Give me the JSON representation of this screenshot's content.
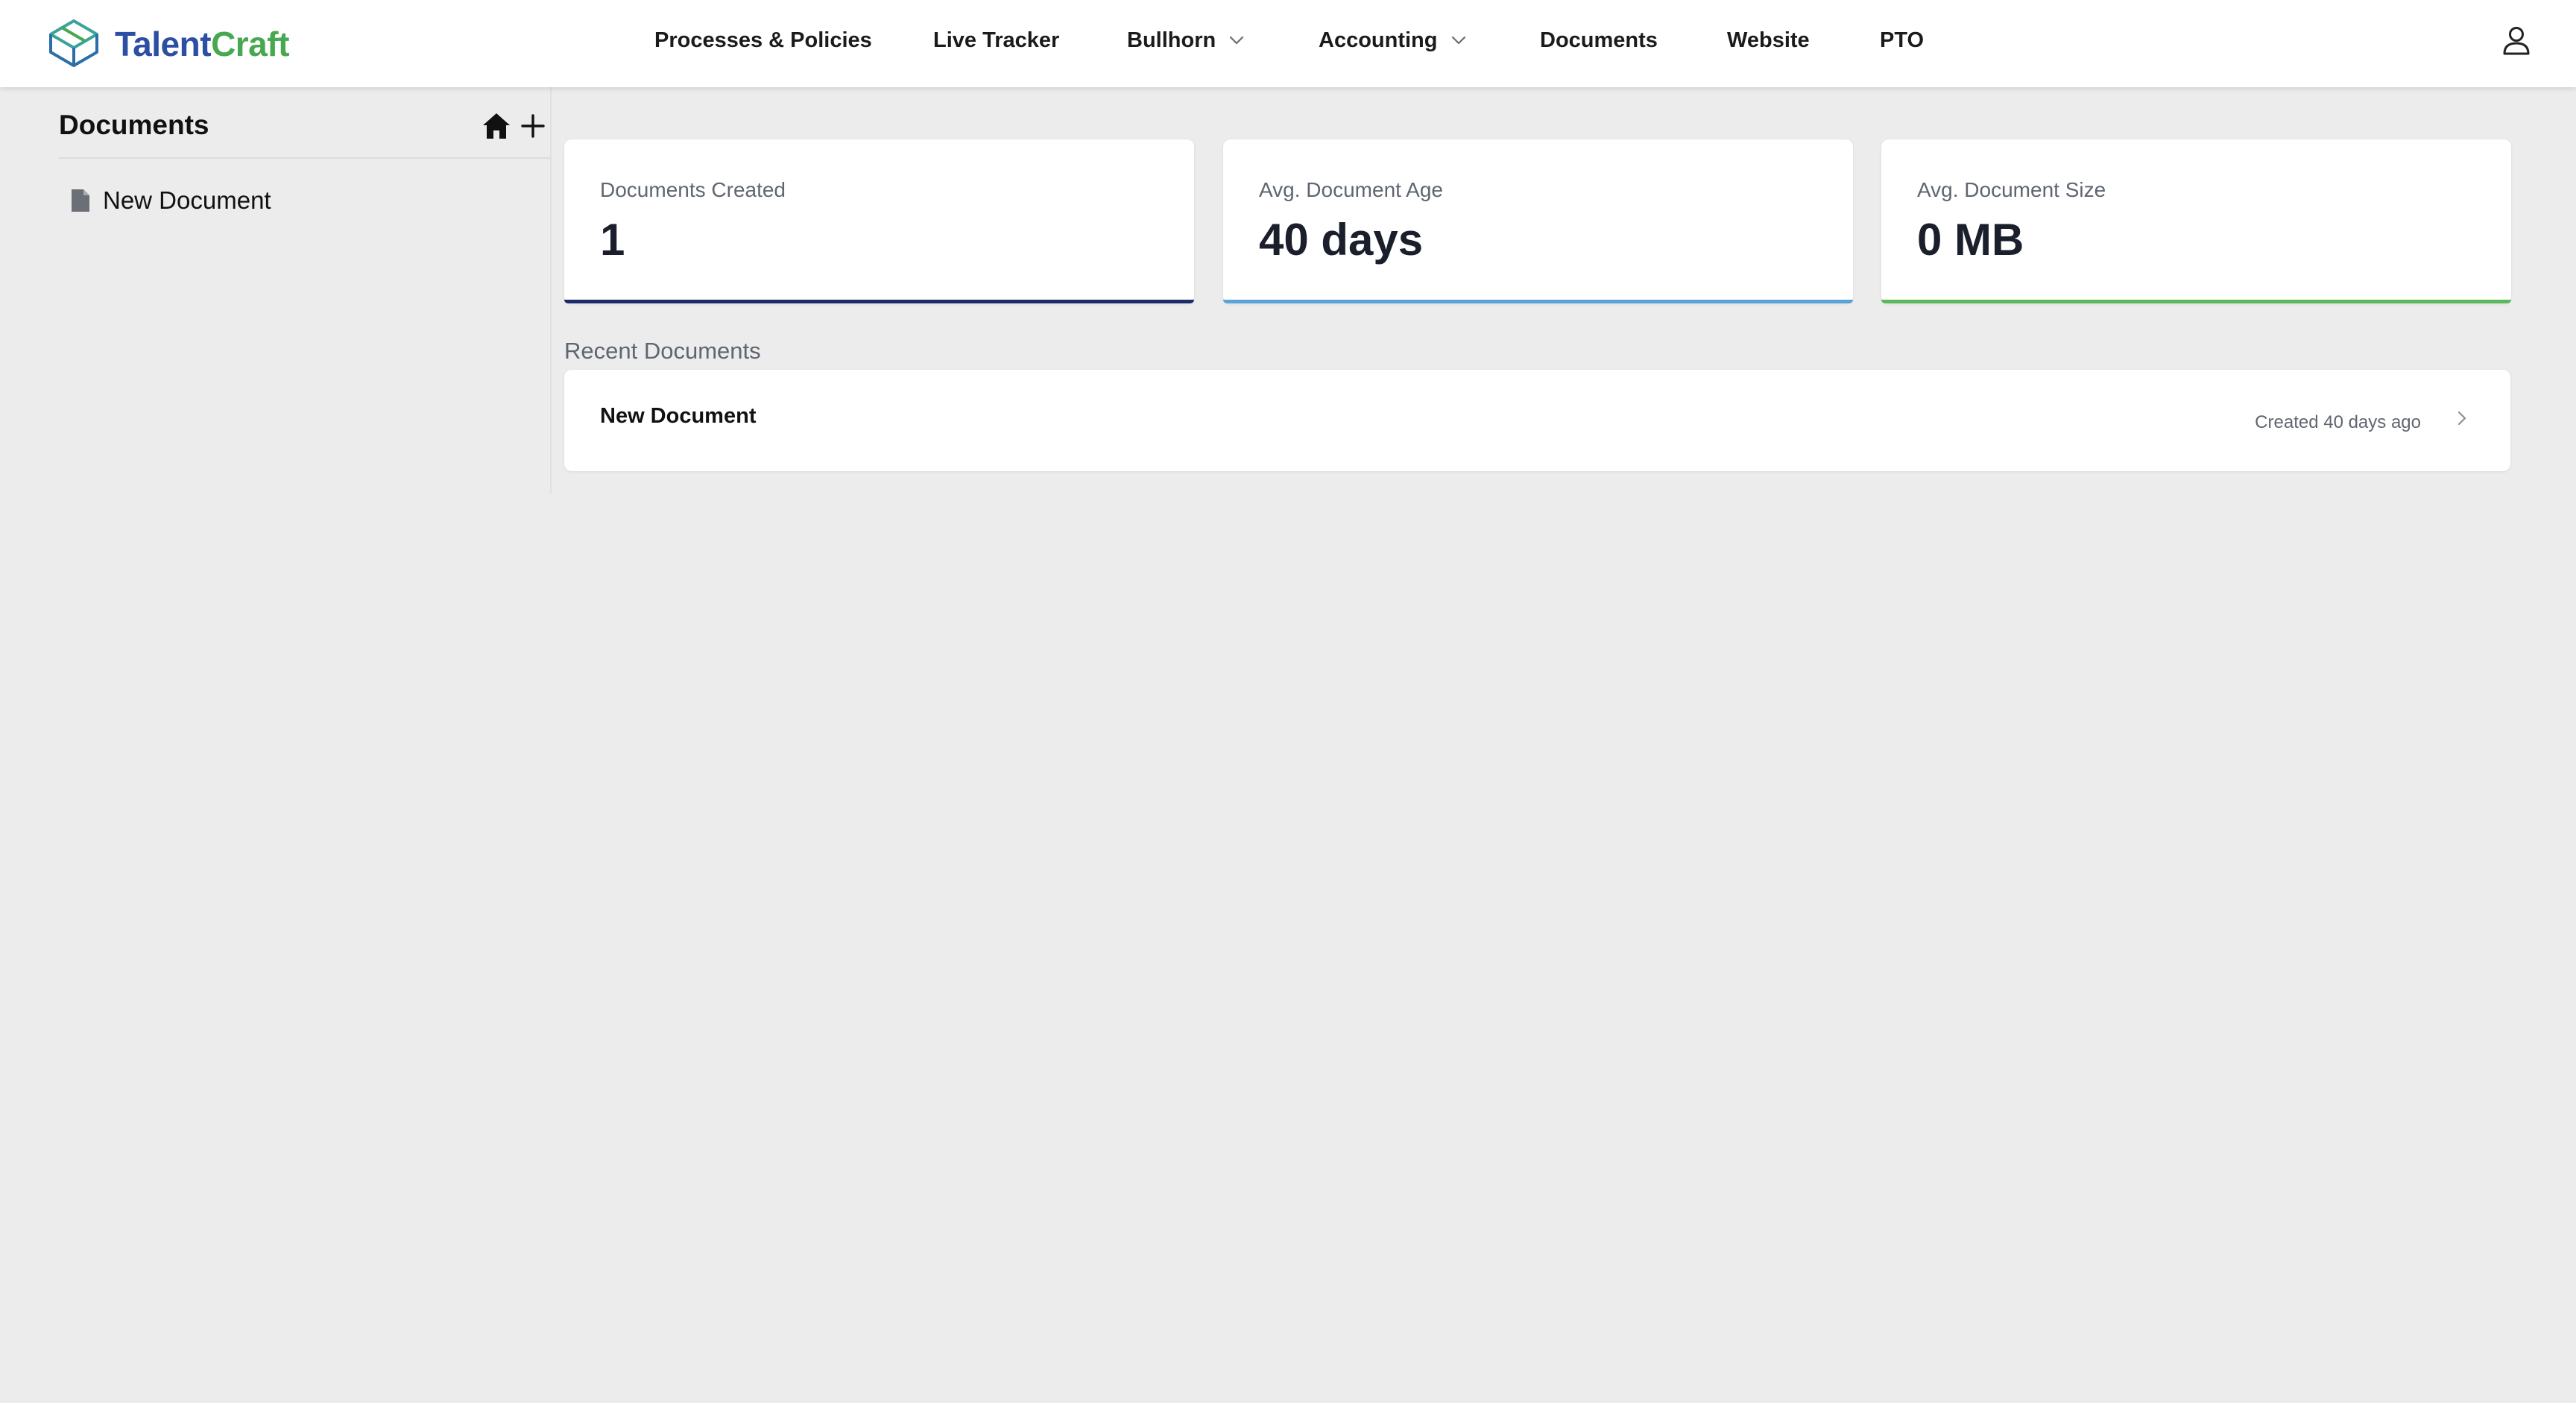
{
  "brand": {
    "name_part1": "Talent",
    "name_part2": "Craft"
  },
  "nav": {
    "items": [
      {
        "label": "Processes & Policies"
      },
      {
        "label": "Live Tracker"
      },
      {
        "label": "Bullhorn"
      },
      {
        "label": "Accounting"
      },
      {
        "label": "Documents"
      },
      {
        "label": "Website"
      },
      {
        "label": "PTO"
      }
    ]
  },
  "sidebar": {
    "title": "Documents",
    "documents": [
      {
        "label": "New Document"
      }
    ]
  },
  "stats": [
    {
      "label": "Documents Created",
      "value": "1",
      "accent": "#1d2b6b"
    },
    {
      "label": "Avg. Document Age",
      "value": "40 days",
      "accent": "#5aa3d9"
    },
    {
      "label": "Avg. Document Size",
      "value": "0 MB",
      "accent": "#5cb85c"
    }
  ],
  "recent": {
    "heading": "Recent Documents",
    "items": [
      {
        "name": "New Document",
        "meta": "Created 40 days ago"
      }
    ]
  },
  "icons": {
    "logo": "cube-logo-icon",
    "dropdown": "chevron-down-icon",
    "user": "user-icon",
    "home": "home-icon",
    "add": "plus-icon",
    "document": "file-icon",
    "open": "chevron-right-icon"
  }
}
